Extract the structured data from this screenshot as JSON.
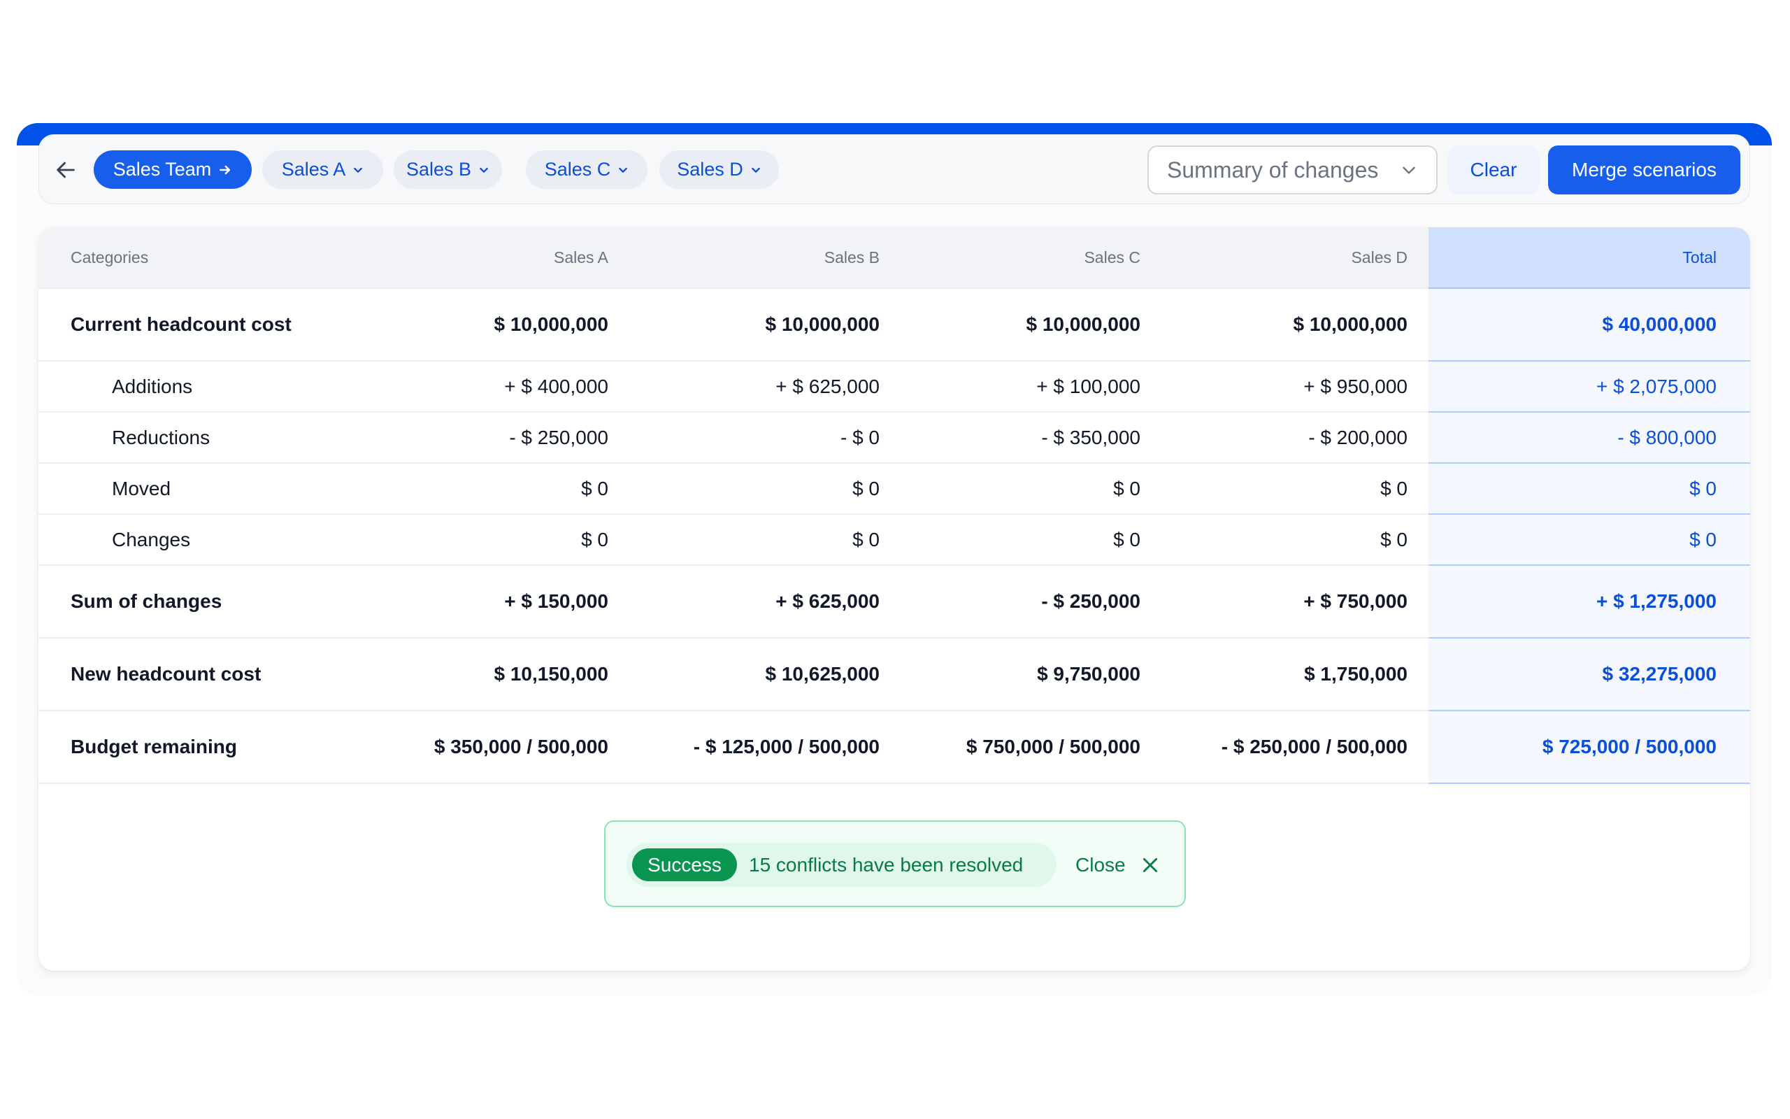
{
  "toolbar": {
    "back_icon": "arrow-left-icon",
    "chips": [
      {
        "label": "Sales Team",
        "icon": "arrow-right-icon",
        "active": true
      },
      {
        "label": "Sales A",
        "icon": "chevron-down-icon",
        "active": false
      },
      {
        "label": "Sales B",
        "icon": "chevron-down-icon",
        "active": false
      },
      {
        "label": "Sales C",
        "icon": "chevron-down-icon",
        "active": false
      },
      {
        "label": "Sales D",
        "icon": "chevron-down-icon",
        "active": false
      }
    ],
    "view_select": {
      "value": "Summary of changes",
      "icon": "chevron-down-icon"
    },
    "clear_label": "Clear",
    "merge_label": "Merge scenarios"
  },
  "table": {
    "headers": [
      "Categories",
      "Sales A",
      "Sales B",
      "Sales C",
      "Sales D",
      "Total"
    ],
    "rows": [
      {
        "kind": "major",
        "cells": [
          "Current headcount cost",
          "$ 10,000,000",
          "$ 10,000,000",
          "$ 10,000,000",
          "$ 10,000,000",
          "$ 40,000,000"
        ]
      },
      {
        "kind": "minor",
        "cells": [
          "Additions",
          "+ $ 400,000",
          "+ $ 625,000",
          "+ $ 100,000",
          "+ $ 950,000",
          "+ $ 2,075,000"
        ]
      },
      {
        "kind": "minor",
        "cells": [
          "Reductions",
          "- $ 250,000",
          "- $ 0",
          "- $ 350,000",
          "- $ 200,000",
          "- $ 800,000"
        ]
      },
      {
        "kind": "minor",
        "cells": [
          "Moved",
          "$ 0",
          "$ 0",
          "$ 0",
          "$ 0",
          "$ 0"
        ]
      },
      {
        "kind": "minor",
        "cells": [
          "Changes",
          "$ 0",
          "$ 0",
          "$ 0",
          "$ 0",
          "$ 0"
        ]
      },
      {
        "kind": "major",
        "cells": [
          "Sum of changes",
          "+ $ 150,000",
          "+ $ 625,000",
          "- $ 250,000",
          "+ $ 750,000",
          "+ $ 1,275,000"
        ]
      },
      {
        "kind": "major",
        "cells": [
          "New headcount cost",
          "$ 10,150,000",
          "$ 10,625,000",
          "$ 9,750,000",
          "$ 1,750,000",
          "$ 32,275,000"
        ]
      },
      {
        "kind": "major",
        "cells": [
          "Budget remaining",
          "$ 350,000 / 500,000",
          "- $ 125,000 / 500,000",
          "$ 750,000 / 500,000",
          "- $ 250,000 / 500,000",
          "$ 725,000 / 500,000"
        ]
      }
    ]
  },
  "toast": {
    "badge": "Success",
    "message": "15 conflicts have been resolved",
    "close_label": "Close",
    "close_icon": "close-icon"
  },
  "colors": {
    "accent": "#175fea",
    "frame_bar": "#0152e8",
    "success": "#0a9650",
    "success_text": "#0a7a45"
  }
}
